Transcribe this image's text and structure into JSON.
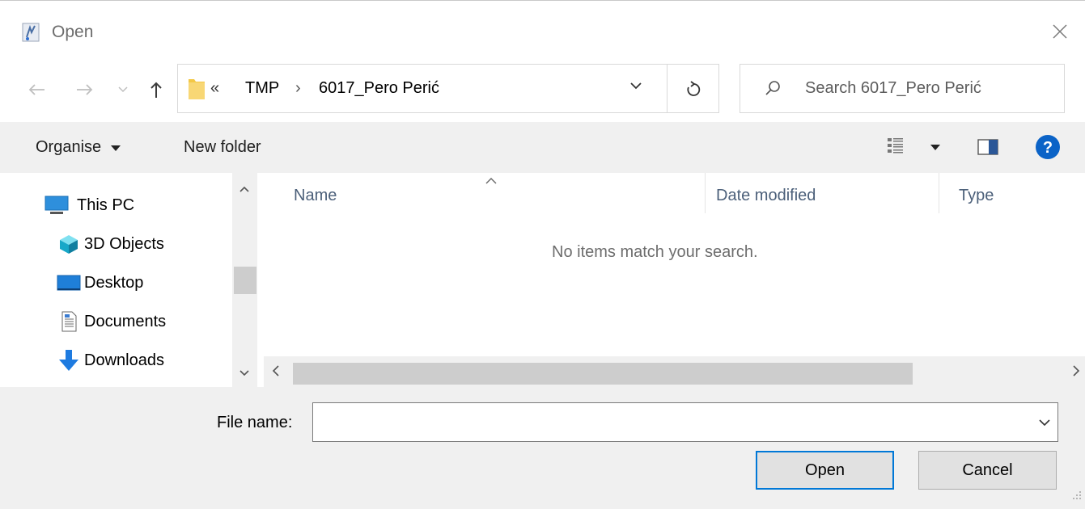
{
  "window": {
    "title": "Open",
    "close_icon": "close-icon",
    "app_icon": "app-icon"
  },
  "nav": {
    "back_icon": "back-arrow-icon",
    "forward_icon": "forward-arrow-icon",
    "recent_icon": "chevron-down-icon",
    "up_icon": "up-arrow-icon",
    "breadcrumb": {
      "overflow": "«",
      "items": [
        "TMP",
        "6017_Pero Perić"
      ],
      "separator": "›"
    },
    "refresh_icon": "refresh-icon",
    "search_placeholder": "Search 6017_Pero Perić"
  },
  "toolbar": {
    "organise_label": "Organise",
    "new_folder_label": "New folder",
    "view_icon": "view-options-icon",
    "preview_pane_icon": "preview-pane-icon",
    "help_icon": "help-icon"
  },
  "sidebar": {
    "items": [
      {
        "label": "This PC",
        "icon": "this-pc-icon"
      },
      {
        "label": "3D Objects",
        "icon": "3d-objects-icon"
      },
      {
        "label": "Desktop",
        "icon": "desktop-icon"
      },
      {
        "label": "Documents",
        "icon": "documents-icon"
      },
      {
        "label": "Downloads",
        "icon": "downloads-icon"
      }
    ]
  },
  "file_list": {
    "columns": [
      "Name",
      "Date modified",
      "Type"
    ],
    "empty_message": "No items match your search."
  },
  "bottom": {
    "file_name_label": "File name:",
    "file_name_value": "",
    "open_label": "Open",
    "cancel_label": "Cancel"
  },
  "colors": {
    "accent": "#0078d7",
    "help": "#0b63c7",
    "folder": "#f3c846"
  }
}
